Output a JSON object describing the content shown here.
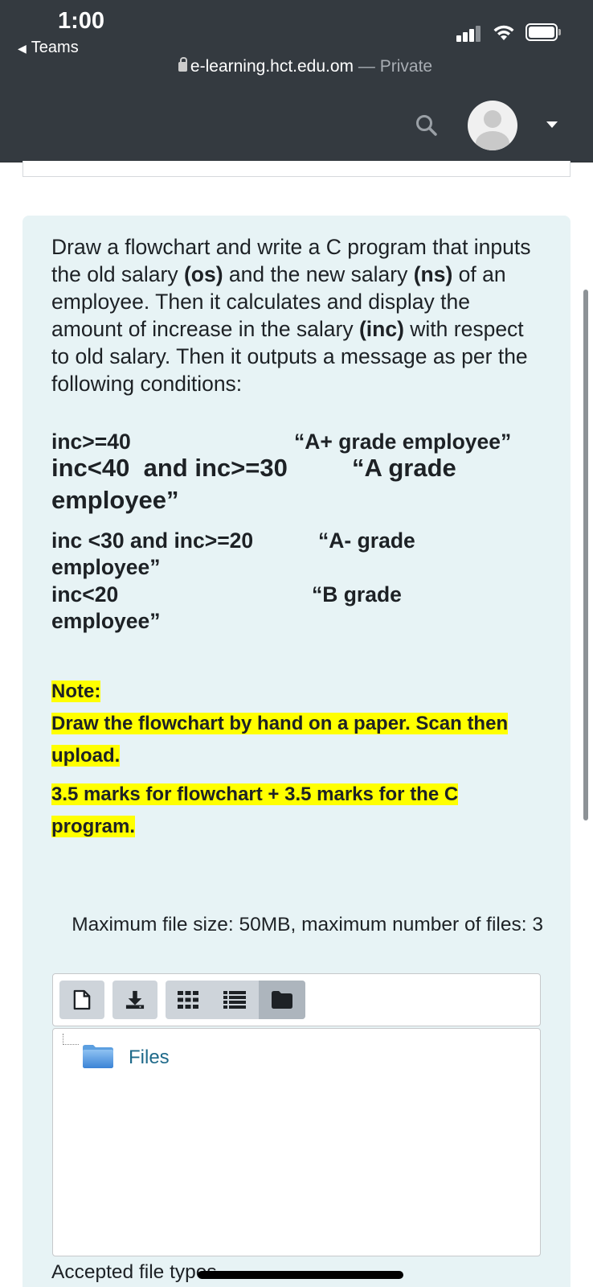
{
  "status_bar": {
    "time": "1:00",
    "back_app": "Teams",
    "icons": [
      "signal-icon",
      "wifi-icon",
      "battery-icon"
    ]
  },
  "browser": {
    "url": "e-learning.hct.edu.om",
    "separator": " — ",
    "mode": "Private"
  },
  "navbar": {
    "icons": [
      "search-icon",
      "avatar",
      "chevron-down-icon"
    ]
  },
  "question": {
    "p1": "Draw a flowchart and write a C program that inputs the old salary ",
    "os": "(os)",
    "p2": " and the new salary ",
    "ns": "(ns)",
    "p3": " of an employee. Then it calculates and display the amount of increase in the salary ",
    "inc": "(inc)",
    "p4": " with respect to old salary. Then it outputs a message as per the following conditions:",
    "conditions": [
      {
        "condition": "inc>=40",
        "message": "“A+ grade employee”"
      },
      {
        "condition": "inc<40  and inc>=30",
        "message": "“A grade",
        "message_cont": "employee”"
      },
      {
        "condition": "inc <30 and inc>=20",
        "message": "“A- grade",
        "message_cont": "employee”"
      },
      {
        "condition": "inc<20",
        "message": "“B grade",
        "message_cont": "employee”"
      }
    ],
    "note_label": "Note:",
    "note_text": "Draw the flowchart by hand on a paper. Scan then upload.",
    "marks_text": "3.5 marks for flowchart + 3.5 marks for the C program.",
    "highlight_color": "#ffff00"
  },
  "file_picker": {
    "max_size_text": "Maximum file size: 50MB, maximum number of files: 3",
    "toolbar": [
      "add-file-icon",
      "download-icon",
      "grid-view-icon",
      "list-view-icon",
      "folder-view-icon"
    ],
    "folder_label": "Files",
    "accepted_label": "Accepted file types"
  },
  "colors": {
    "header_bg": "#343a40",
    "card_bg": "#e7f3f5",
    "link": "#1f6a8a"
  }
}
